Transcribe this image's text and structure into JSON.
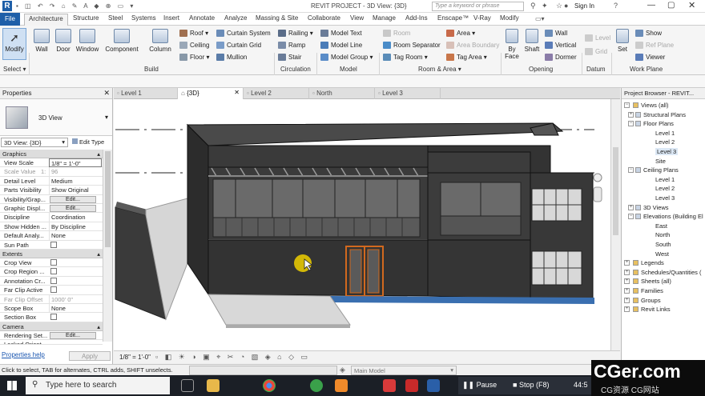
{
  "titlebar": {
    "title": "REVIT PROJECT - 3D View: {3D}",
    "search_placeholder": "Type a keyword or phrase",
    "sign_in": "Sign In",
    "app_letter": "R"
  },
  "tabs": [
    "File",
    "Architecture",
    "Structure",
    "Steel",
    "Systems",
    "Insert",
    "Annotate",
    "Analyze",
    "Massing & Site",
    "Collaborate",
    "View",
    "Manage",
    "Add-Ins",
    "Enscape™",
    "V-Ray",
    "Modify"
  ],
  "ribbon": {
    "select": {
      "modify": "Modify",
      "panel": "Select"
    },
    "build": {
      "wall": "Wall",
      "door": "Door",
      "window": "Window",
      "component": "Component",
      "column": "Column",
      "roof": "Roof",
      "ceiling": "Ceiling",
      "floor": "Floor",
      "curtain_system": "Curtain System",
      "curtain_grid": "Curtain Grid",
      "mullion": "Mullion",
      "panel": "Build"
    },
    "circulation": {
      "railing": "Railing",
      "ramp": "Ramp",
      "stair": "Stair",
      "panel": "Circulation"
    },
    "model": {
      "model_text": "Model Text",
      "model_line": "Model Line",
      "model_group": "Model Group",
      "panel": "Model"
    },
    "room_area": {
      "room": "Room",
      "room_separator": "Room Separator",
      "tag_room": "Tag Room",
      "area": "Area",
      "area_boundary": "Area Boundary",
      "tag_area": "Tag Area",
      "panel": "Room & Area"
    },
    "opening": {
      "by_face": "By Face",
      "shaft": "Shaft",
      "wall": "Wall",
      "vertical": "Vertical",
      "dormer": "Dormer",
      "panel": "Opening"
    },
    "datum": {
      "level": "Level",
      "grid": "Grid",
      "panel": "Datum"
    },
    "work_plane": {
      "set": "Set",
      "show": "Show",
      "ref_plane": "Ref Plane",
      "viewer": "Viewer",
      "panel": "Work Plane"
    }
  },
  "properties": {
    "header": "Properties",
    "type_name": "3D View",
    "selector": "3D View: {3D}",
    "edit_type": "Edit Type",
    "sections": {
      "graphics": "Graphics",
      "extents": "Extents",
      "camera": "Camera"
    },
    "graphics_rows": [
      {
        "key": "View Scale",
        "value": "1/8\" = 1'-0\""
      },
      {
        "key": "Scale Value",
        "value": "96"
      },
      {
        "key": "Detail Level",
        "value": "Medium"
      },
      {
        "key": "Parts Visibility",
        "value": "Show Original"
      },
      {
        "key": "Visibility/Grap...",
        "value": "Edit..."
      },
      {
        "key": "Graphic Displ...",
        "value": "Edit..."
      },
      {
        "key": "Discipline",
        "value": "Coordination"
      },
      {
        "key": "Show Hidden ...",
        "value": "By Discipline"
      },
      {
        "key": "Default Analy...",
        "value": "None"
      },
      {
        "key": "Sun Path",
        "value": ""
      }
    ],
    "scale_value_prefix": "1:",
    "extents_rows": [
      {
        "key": "Crop View",
        "value": ""
      },
      {
        "key": "Crop Region ...",
        "value": ""
      },
      {
        "key": "Annotation Cr...",
        "value": ""
      },
      {
        "key": "Far Clip Active",
        "value": ""
      },
      {
        "key": "Far Clip Offset",
        "value": "1000' 0\""
      },
      {
        "key": "Scope Box",
        "value": "None"
      },
      {
        "key": "Section Box",
        "value": ""
      }
    ],
    "camera_rows": [
      {
        "key": "Rendering Set...",
        "value": "Edit..."
      },
      {
        "key": "Locked Orient...",
        "value": ""
      }
    ],
    "help_link": "Properties help",
    "apply": "Apply"
  },
  "view_tabs": [
    "Level 1",
    "{3D}",
    "Level 2",
    "North",
    "Level 3"
  ],
  "view_control": {
    "scale": "1/8\" = 1'-0\""
  },
  "project_browser": {
    "header": "Project Browser - REVIT...",
    "nodes": [
      {
        "label": "Views (all)",
        "level": 0
      },
      {
        "label": "Structural Plans",
        "level": 1
      },
      {
        "label": "Floor Plans",
        "level": 1
      },
      {
        "label": "Level 1",
        "level": 2
      },
      {
        "label": "Level 2",
        "level": 2
      },
      {
        "label": "Level 3",
        "level": 2
      },
      {
        "label": "Site",
        "level": 2
      },
      {
        "label": "Ceiling Plans",
        "level": 1
      },
      {
        "label": "Level 1",
        "level": 2
      },
      {
        "label": "Level 2",
        "level": 2
      },
      {
        "label": "Level 3",
        "level": 2
      },
      {
        "label": "3D Views",
        "level": 1
      },
      {
        "label": "Elevations (Building El",
        "level": 1
      },
      {
        "label": "East",
        "level": 2
      },
      {
        "label": "North",
        "level": 2
      },
      {
        "label": "South",
        "level": 2
      },
      {
        "label": "West",
        "level": 2
      },
      {
        "label": "Legends",
        "level": 0
      },
      {
        "label": "Schedules/Quantities (",
        "level": 0
      },
      {
        "label": "Sheets (all)",
        "level": 0
      },
      {
        "label": "Families",
        "level": 0
      },
      {
        "label": "Groups",
        "level": 0
      },
      {
        "label": "Revit Links",
        "level": 0
      }
    ]
  },
  "status": {
    "message": "Click to select, TAB for alternates, CTRL adds, SHIFT unselects.",
    "model": "Main Model"
  },
  "taskbar": {
    "search": "Type here to search",
    "pause": "Pause",
    "stop": "Stop (F8)",
    "time": "44:5"
  },
  "watermark": {
    "main": "CGer.com",
    "sub": "CG资源 CG网站"
  },
  "colors": {
    "file_tab": "#1e5fa8",
    "building": "#3e3e3e",
    "door_frame": "#d2691e",
    "base_blue": "#3a6fb0",
    "cursor": "#f0d000"
  }
}
